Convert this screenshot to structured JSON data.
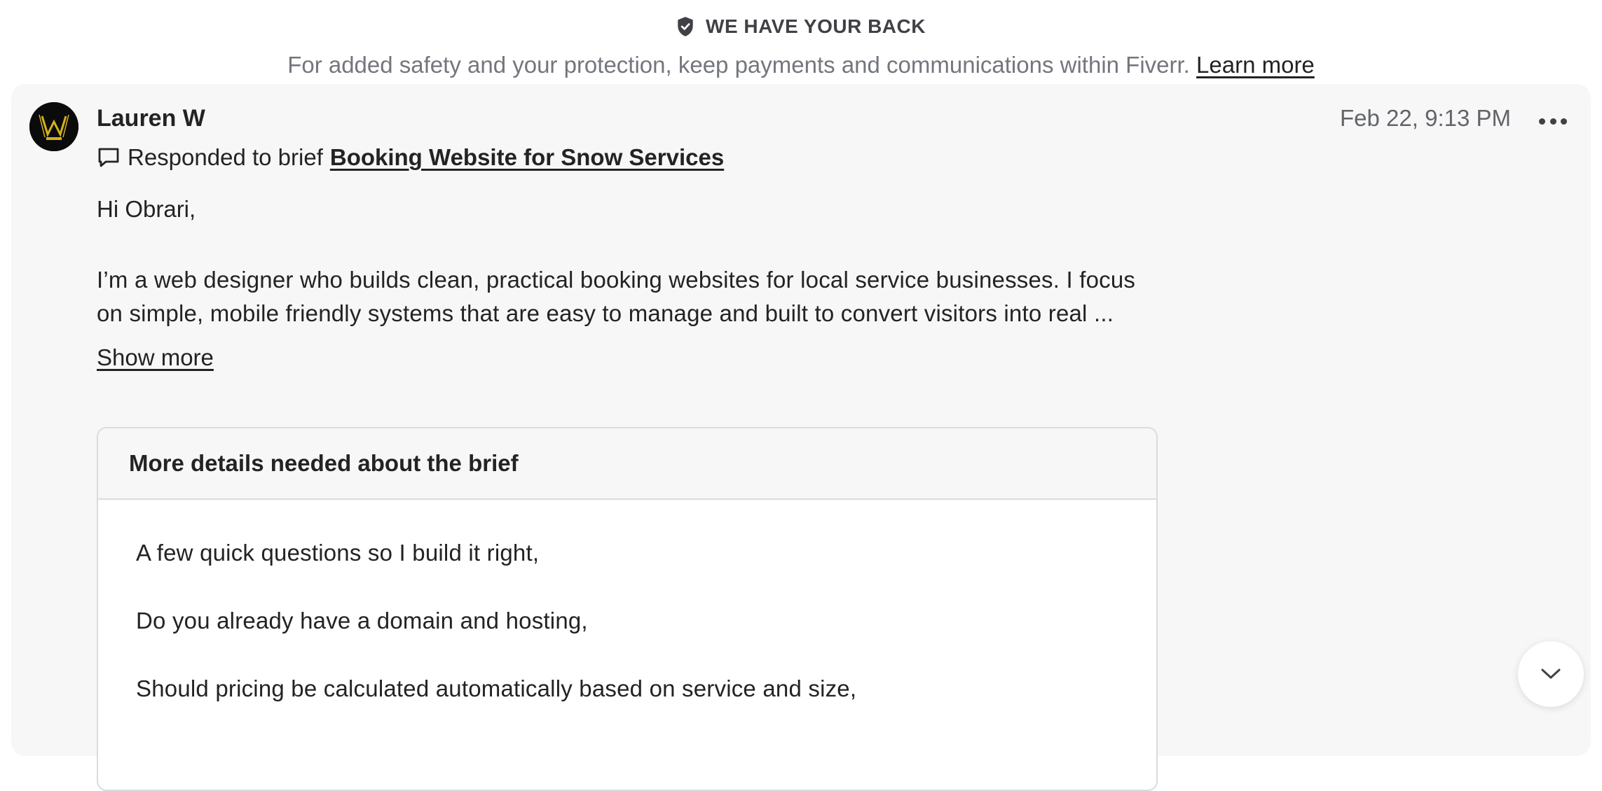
{
  "safety_banner": {
    "title": "WE HAVE YOUR BACK",
    "text": "For added safety and your protection, keep payments and communications within Fiverr.",
    "link_label": "Learn more"
  },
  "message": {
    "sender": "Lauren W",
    "timestamp": "Feb 22, 9:13 PM",
    "brief_prefix": "Responded to brief",
    "brief_title": "Booking Website for Snow Services",
    "greeting": "Hi Obrari,",
    "body_line_1": "I’m a web designer who builds clean, practical booking websites for local service businesses. I focus",
    "body_line_2": "on simple, mobile friendly systems that are easy to manage and built to convert visitors into real ...",
    "show_more_label": "Show more",
    "details": {
      "title": "More details needed about the brief",
      "questions": [
        "A few quick questions so I build it right,",
        "Do you already have a domain and hosting,",
        "Should pricing be calculated automatically based on service and size,"
      ]
    }
  },
  "icons": {
    "shield": "shield-check-icon",
    "chat": "chat-bubble-icon",
    "more": "more-dots-icon",
    "scroll": "chevron-down-icon"
  }
}
